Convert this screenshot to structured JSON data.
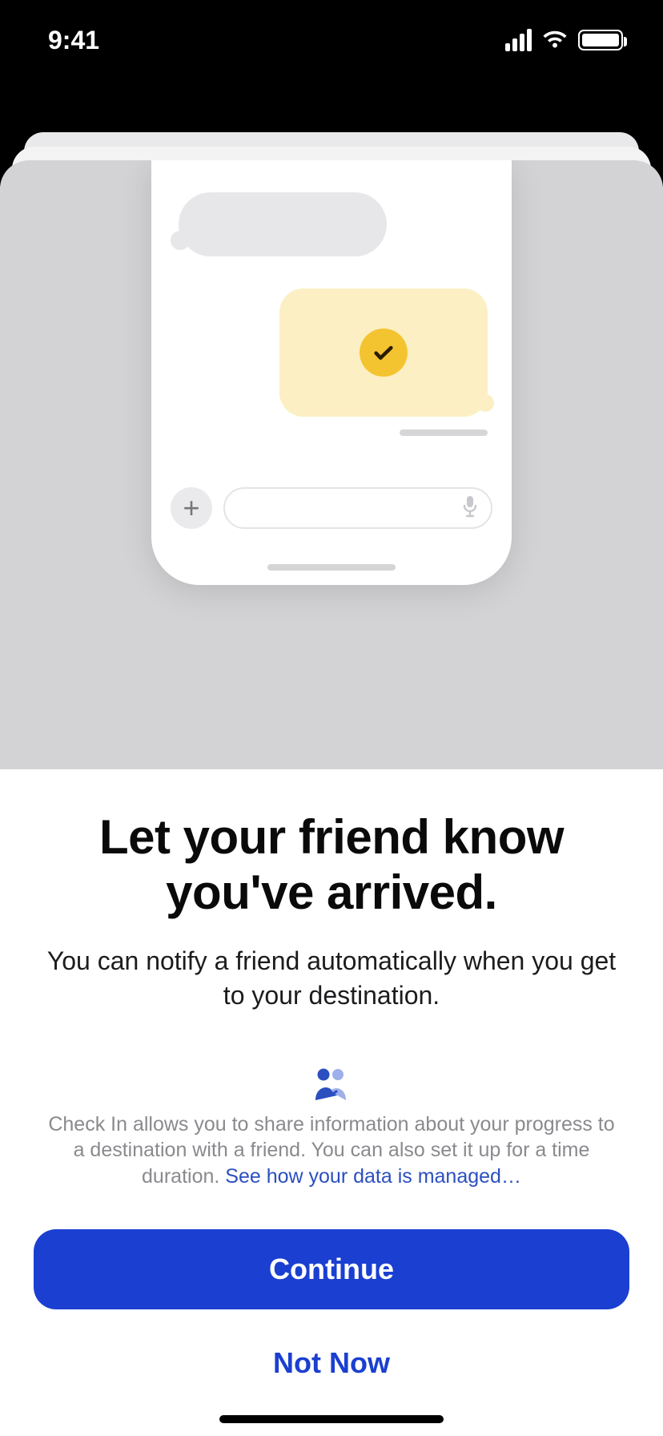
{
  "status": {
    "time": "9:41"
  },
  "illustration": {
    "plus_icon": "plus-icon",
    "mic_icon": "microphone-icon",
    "check_icon": "checkmark-icon"
  },
  "content": {
    "title": "Let your friend know you've arrived.",
    "subtitle": "You can notify a friend automatically when you get to your destination.",
    "info_text": "Check In allows you to share information about your progress to a destination with a friend. You can also set it up for a time duration. ",
    "data_link": "See how your data is managed…"
  },
  "actions": {
    "primary": "Continue",
    "secondary": "Not Now"
  }
}
